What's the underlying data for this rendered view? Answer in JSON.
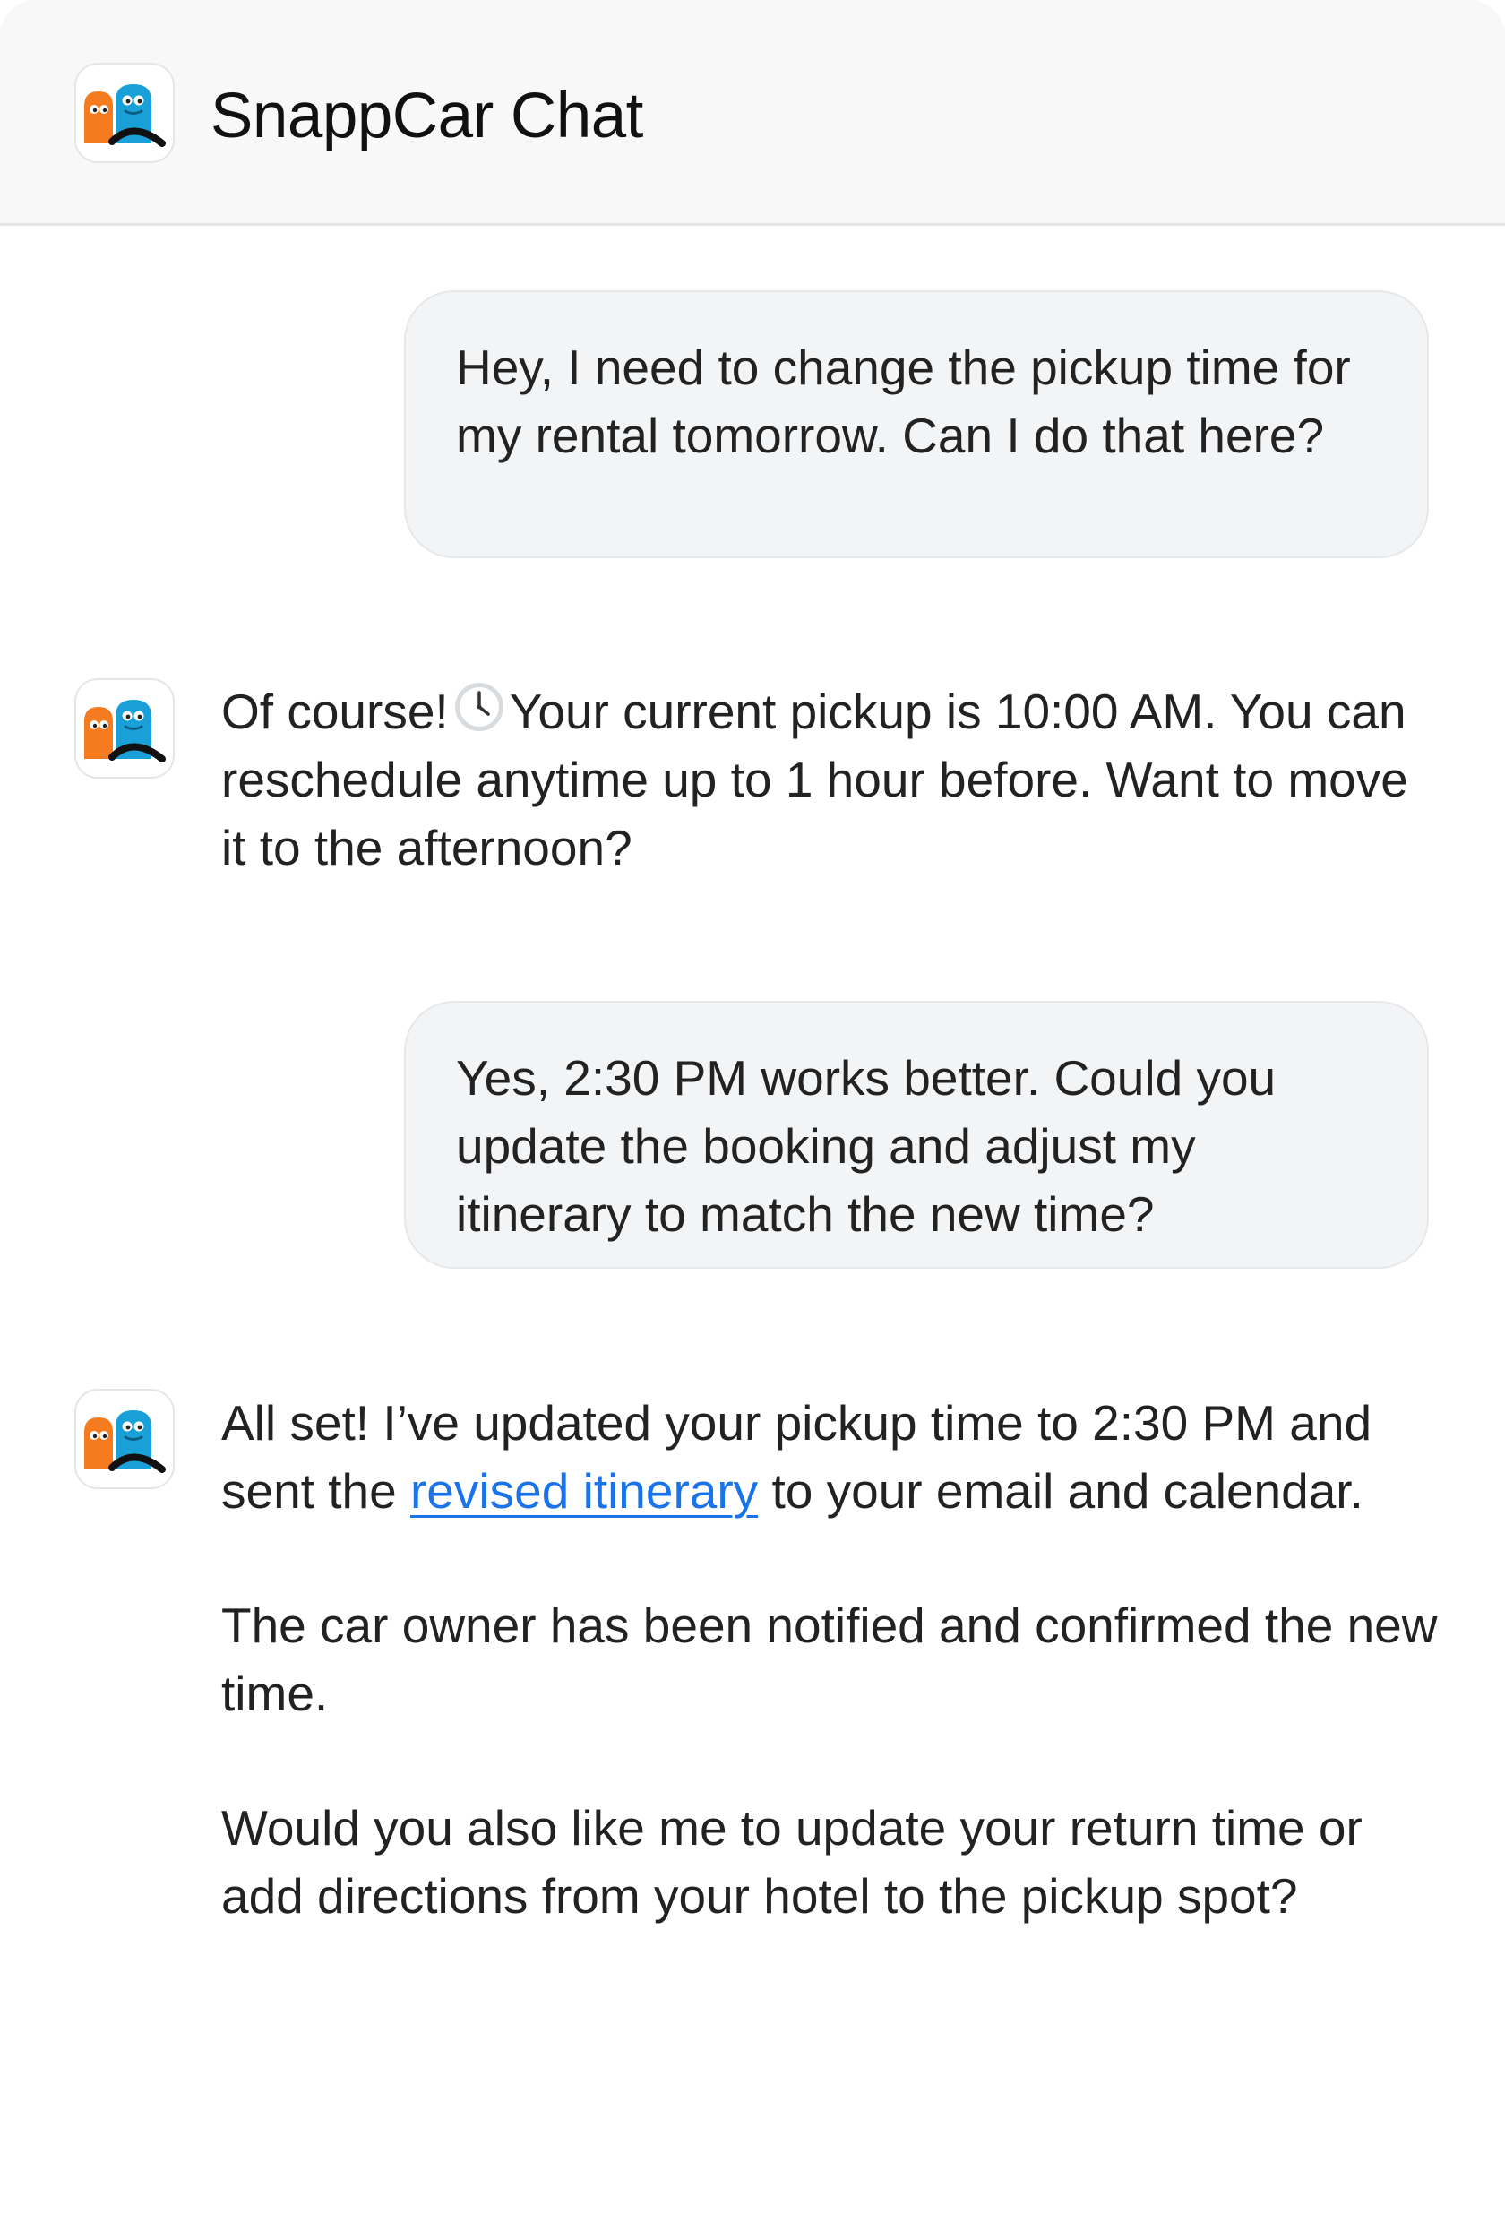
{
  "header": {
    "title": "SnappCar Chat",
    "logo_icon": "snappcar-mascots-icon"
  },
  "colors": {
    "orange_mascot": "#F47B20",
    "blue_mascot": "#1AA0D8",
    "link": "#1a73e8",
    "user_bubble": "#f3f4f6"
  },
  "messages": [
    {
      "sender": "user",
      "text": "Hey, I need to change the pickup time for my rental tomorrow. Can I do that here?"
    },
    {
      "sender": "bot",
      "part1": "Of course!",
      "emoji_icon": "clock-icon",
      "part2": "Your current pickup is 10:00 AM. You can reschedule anytime up to 1 hour before. Want to move it to the afternoon?"
    },
    {
      "sender": "user",
      "text": "Yes, 2:30 PM works better. Could you update the booking and adjust my itinerary to match the new time?"
    },
    {
      "sender": "bot",
      "para1_before": "All set! I’ve updated your pickup time to 2:30 PM and sent the",
      "para1_link": "revised itinerary",
      "para1_after": "to your email and calendar.",
      "para2": "The car owner has been notified and confirmed the new time.",
      "para3": "Would you also like me to update your return time or add directions from your hotel to the pickup spot?"
    }
  ]
}
